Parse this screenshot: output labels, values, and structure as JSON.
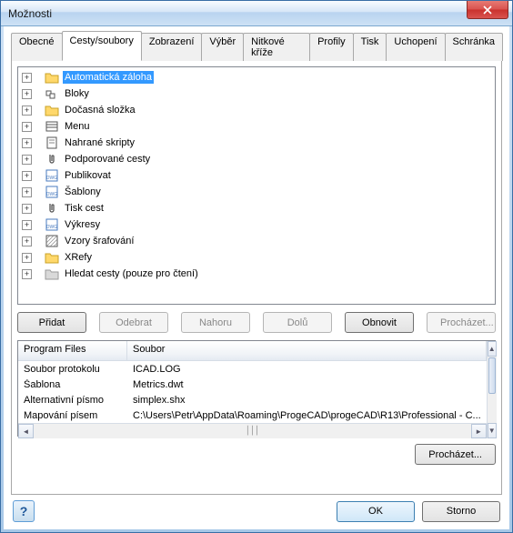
{
  "window": {
    "title": "Možnosti"
  },
  "tabs": [
    "Obecné",
    "Cesty/soubory",
    "Zobrazení",
    "Výběr",
    "Nitkové kříže",
    "Profily",
    "Tisk",
    "Uchopení",
    "Schránka"
  ],
  "active_tab_index": 1,
  "tree": [
    {
      "icon": "folder-yellow",
      "label": "Automatická záloha",
      "selected": true
    },
    {
      "icon": "blocks",
      "label": "Bloky"
    },
    {
      "icon": "folder-yellow",
      "label": "Dočasná složka"
    },
    {
      "icon": "menu",
      "label": "Menu"
    },
    {
      "icon": "script",
      "label": "Nahrané skripty"
    },
    {
      "icon": "clip",
      "label": "Podporované cesty"
    },
    {
      "icon": "dwg",
      "label": "Publikovat"
    },
    {
      "icon": "dwg",
      "label": "Šablony"
    },
    {
      "icon": "clip",
      "label": "Tisk cest"
    },
    {
      "icon": "dwg",
      "label": "Výkresy"
    },
    {
      "icon": "hatch",
      "label": "Vzory šrafování"
    },
    {
      "icon": "folder-yellow",
      "label": "XRefy"
    },
    {
      "icon": "folder-gray",
      "label": "Hledat cesty (pouze pro čtení)"
    }
  ],
  "buttons": {
    "add": "Přidat",
    "remove": "Odebrat",
    "up": "Nahoru",
    "down": "Dolů",
    "refresh": "Obnovit",
    "browse": "Procházet...",
    "browse2": "Procházet...",
    "ok": "OK",
    "cancel": "Storno",
    "help": "?"
  },
  "table": {
    "headers": [
      "Program Files",
      "Soubor"
    ],
    "rows": [
      {
        "c0": "Soubor protokolu",
        "c1": "ICAD.LOG"
      },
      {
        "c0": "Šablona",
        "c1": "Metrics.dwt"
      },
      {
        "c0": "Alternativní písmo",
        "c1": "simplex.shx"
      },
      {
        "c0": "Mapování písem",
        "c1": "C:\\Users\\Petr\\AppData\\Roaming\\ProgeCAD\\progeCAD\\R13\\Professional - C..."
      }
    ]
  }
}
